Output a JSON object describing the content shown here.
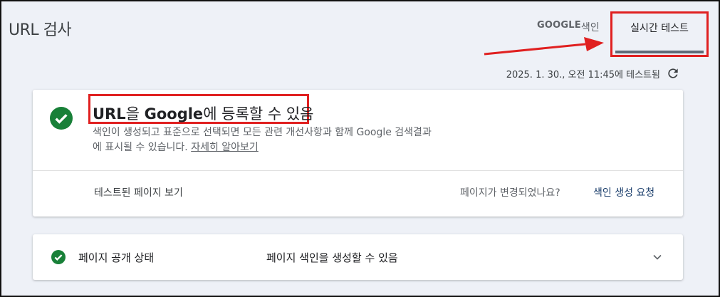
{
  "header": {
    "title": "URL 검사",
    "tabs": [
      {
        "label_prefix": "GOOGLE",
        "label_suffix": " 색인"
      },
      {
        "label": "실시간 테스트"
      }
    ],
    "tested_at": "2025. 1. 30., 오전 11:45에 테스트됨"
  },
  "result": {
    "headline_strong": "URL",
    "headline_mid": "을 ",
    "headline_strong2": "Google",
    "headline_end": "에 등록할 수 있음",
    "description_line1": "색인이 생성되고 표준으로 선택되면 모든 관련 개선사항과 함께 Google 검색결과",
    "description_line2": "에 표시될 수 있습니다.",
    "learn_more": "자세히 알아보기",
    "view_tested_page": "테스트된 페이지 보기",
    "changed_question": "페이지가 변경되었나요?",
    "request_indexing": "색인 생성 요청"
  },
  "availability": {
    "label": "페이지 공개 상태",
    "value": "페이지 색인을 생성할 수 있음"
  },
  "colors": {
    "success_green": "#188038",
    "highlight_red": "#e02020",
    "link_blue": "#1a3d6b"
  },
  "icons": {
    "check": "check-circle-icon",
    "refresh": "refresh-icon",
    "expand": "chevron-down-icon"
  }
}
